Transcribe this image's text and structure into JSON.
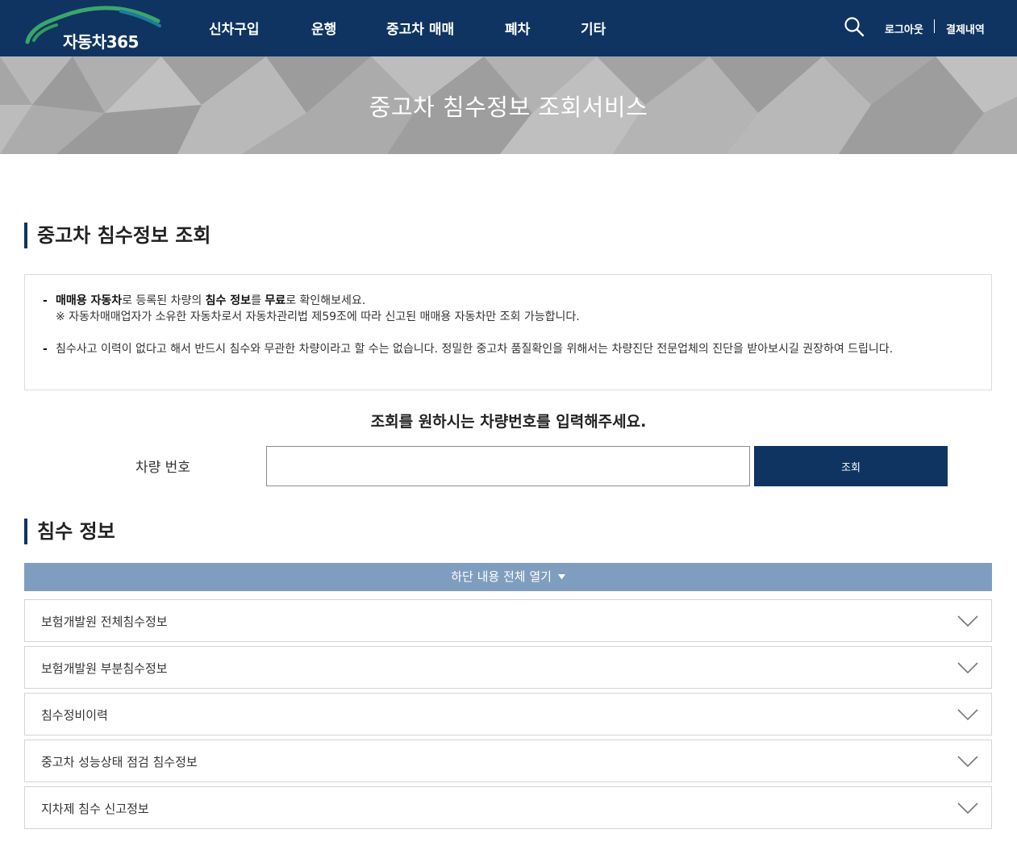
{
  "header": {
    "logo_text": "자동차365",
    "nav": [
      "신차구입",
      "운행",
      "중고차 매매",
      "폐차",
      "기타"
    ],
    "search_icon": "search-icon",
    "logout": "로그아웃",
    "payment_history": "결제내역"
  },
  "banner": {
    "title": "중고차 침수정보 조회서비스"
  },
  "lookup_section": {
    "title": "중고차 침수정보 조회",
    "notice": {
      "line1_bold1": "매매용 자동차",
      "line1_text1": "로 등록된 차량의 ",
      "line1_bold2": "침수 정보",
      "line1_text2": "를 ",
      "line1_bold3": "무료",
      "line1_text3": "로 확인해보세요.",
      "line2": "※ 자동차매매업자가 소유한 자동차로서 자동차관리법 제59조에 따라 신고된 매매용 자동차만 조회 가능합니다.",
      "line3": "침수사고 이력이 없다고 해서 반드시 침수와 무관한 차량이라고 할 수는 없습니다. 정밀한 중고차 품질확인을 위해서는 차량진단 전문업체의 진단을 받아보시길 권장하여 드립니다."
    },
    "prompt": "조회를 원하시는 차량번호를 입력해주세요.",
    "plate_label": "차량 번호",
    "plate_value": "",
    "query_button": "조회"
  },
  "flood_section": {
    "title": "침수 정보",
    "expand_all": "하단 내용 전체 열기",
    "expand_icon": "triangle-down-icon",
    "items": [
      "보험개발원 전체침수정보",
      "보험개발원 부분침수정보",
      "침수정비이력",
      "중고차 성능상태 점검 침수정보",
      "지차제 침수 신고정보"
    ],
    "item_icon": "chevron-down-icon"
  },
  "colors": {
    "header_bg": "#0f3461",
    "accent": "#0f3461",
    "expand_bar": "#7f9dbf",
    "logo_arc_green": "#3aa66b",
    "logo_arc_teal": "#1f7a9c"
  }
}
